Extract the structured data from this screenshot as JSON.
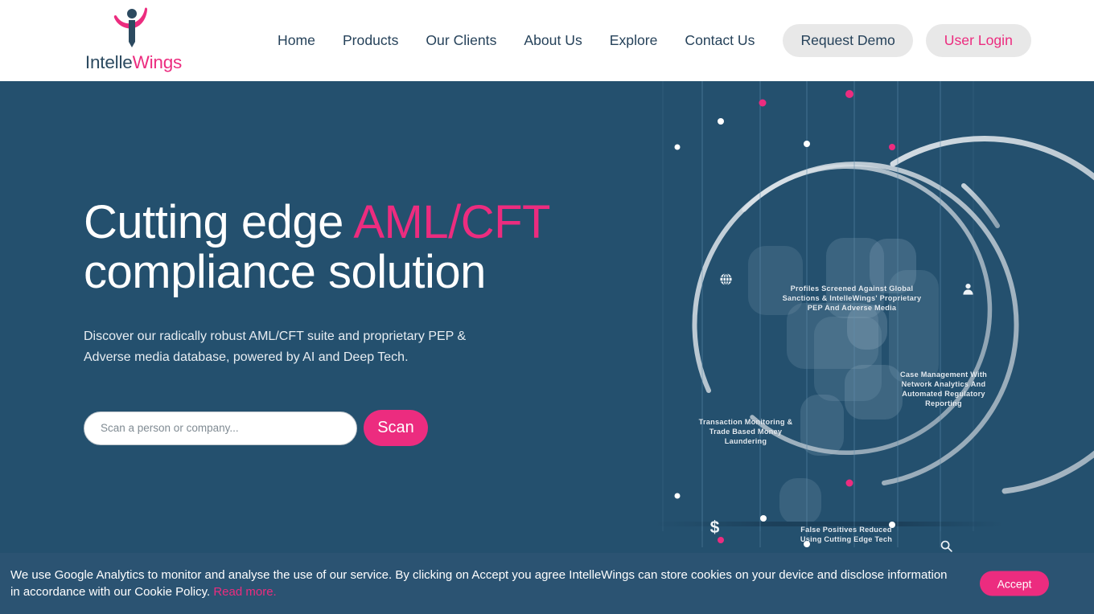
{
  "brand": {
    "name_part1": "Intelle",
    "name_part2": "Wings",
    "logo_icon": "intellewings-figure-logo",
    "accent_pink": "#ec2c7f",
    "navy": "#26425a",
    "hero_bg": "#24506e"
  },
  "nav": {
    "items": [
      {
        "label": "Home"
      },
      {
        "label": "Products"
      },
      {
        "label": "Our Clients"
      },
      {
        "label": "About Us"
      },
      {
        "label": "Explore"
      },
      {
        "label": "Contact Us"
      }
    ],
    "request_demo": "Request Demo",
    "user_login": "User Login"
  },
  "hero": {
    "headline_part1": "Cutting edge ",
    "headline_accent": "AML/CFT",
    "headline_part2": "compliance solution",
    "subhead": "Discover our radically robust AML/CFT suite and proprietary PEP & Adverse media database, powered by AI and Deep Tech.",
    "search_placeholder": "Scan a person or company...",
    "search_value": "",
    "scan_label": "Scan"
  },
  "graphic": {
    "labels": [
      {
        "text": "Profiles Screened Against Global Sanctions & IntelleWings' Proprietary PEP And Adverse Media"
      },
      {
        "text": "Case Management With Network Analytics And Automated Regulatory Reporting"
      },
      {
        "text": "Transaction Monitoring & Trade Based Money Laundering"
      },
      {
        "text": "False Positives Reduced Using Cutting Edge Tech"
      }
    ],
    "icons": [
      "globe-icon",
      "person-icon",
      "dollar-icon",
      "magnifier-icon"
    ],
    "dollar_glyph": "$"
  },
  "cookie": {
    "text": "We use Google Analytics to monitor and analyse the use of our service. By clicking on Accept you agree IntelleWings can store cookies on your device and disclose information in accordance with our Cookie Policy. ",
    "link": "Read more.",
    "accept_label": "Accept"
  }
}
